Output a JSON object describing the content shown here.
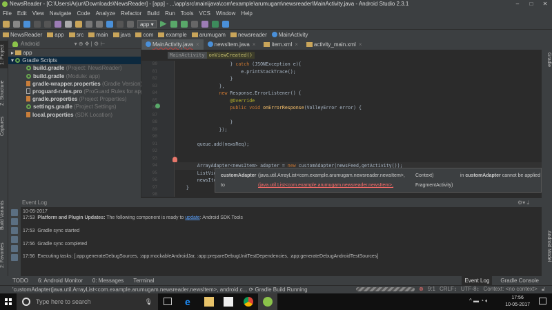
{
  "window": {
    "title": "NewsReader - [C:\\Users\\Arjun\\Downloads\\NewsReader] - [app] - ...\\app\\src\\main\\java\\com\\example\\arumugam\\newsreader\\MainActivity.java - Android Studio 2.3.1"
  },
  "menu": [
    "File",
    "Edit",
    "View",
    "Navigate",
    "Code",
    "Analyze",
    "Refactor",
    "Build",
    "Run",
    "Tools",
    "VCS",
    "Window",
    "Help"
  ],
  "toolbar": {
    "run_config": "app"
  },
  "navbar": [
    "NewsReader",
    "app",
    "src",
    "main",
    "java",
    "com",
    "example",
    "arumugam",
    "newsreader",
    "MainActivity"
  ],
  "left_tabs": [
    "1: Project",
    "Z: Structure",
    "Captures",
    "Build Variants",
    "2: Favorites"
  ],
  "right_tabs": [
    "Gradle",
    "Android Model"
  ],
  "project": {
    "view": "Android",
    "tree": [
      {
        "name": "app",
        "hint": "",
        "icon": "folder",
        "level": 0
      },
      {
        "name": "Gradle Scripts",
        "hint": "",
        "icon": "gradle",
        "level": 0,
        "selected": true
      },
      {
        "name": "build.gradle",
        "hint": "(Project: NewsReader)",
        "icon": "gradle",
        "level": 1
      },
      {
        "name": "build.gradle",
        "hint": "(Module: app)",
        "icon": "gradle",
        "level": 1
      },
      {
        "name": "gradle-wrapper.properties",
        "hint": "(Gradle Version)",
        "icon": "props",
        "level": 1
      },
      {
        "name": "proguard-rules.pro",
        "hint": "(ProGuard Rules for app)",
        "icon": "text",
        "level": 1
      },
      {
        "name": "gradle.properties",
        "hint": "(Project Properties)",
        "icon": "props",
        "level": 1
      },
      {
        "name": "settings.gradle",
        "hint": "(Project Settings)",
        "icon": "gradle",
        "level": 1
      },
      {
        "name": "local.properties",
        "hint": "(SDK Location)",
        "icon": "props",
        "level": 1
      }
    ]
  },
  "editor": {
    "tabs": [
      {
        "label": "MainActivity.java",
        "icon": "class",
        "active": true
      },
      {
        "label": "newsItem.java",
        "icon": "class"
      },
      {
        "label": "item.xml",
        "icon": "xml"
      },
      {
        "label": "activity_main.xml",
        "icon": "xml"
      }
    ],
    "breadcrumb": [
      "MainActivity",
      "onViewCreated()"
    ],
    "lines": [
      {
        "n": "80",
        "segs": [
          [
            "                    } ",
            ""
          ],
          [
            "catch",
            "k"
          ],
          [
            " (JSONException e){",
            ""
          ]
        ]
      },
      {
        "n": "81",
        "segs": [
          [
            "                        e.printStackTrace();",
            ""
          ]
        ]
      },
      {
        "n": "82",
        "segs": [
          [
            "                    }",
            ""
          ]
        ]
      },
      {
        "n": "83",
        "segs": [
          [
            "                },",
            ""
          ]
        ]
      },
      {
        "n": "84",
        "segs": [
          [
            "                ",
            ""
          ],
          [
            "new",
            "k"
          ],
          [
            " Response.ErrorListener() {",
            ""
          ]
        ]
      },
      {
        "n": "85",
        "segs": [
          [
            "                    ",
            ""
          ],
          [
            "@Override",
            "a"
          ]
        ]
      },
      {
        "n": "86",
        "segs": [
          [
            "                    ",
            ""
          ],
          [
            "public void",
            "k"
          ],
          [
            " ",
            ""
          ],
          [
            "onErrorResponse",
            "f"
          ],
          [
            "(VolleyError error) {",
            ""
          ]
        ]
      },
      {
        "n": "87",
        "segs": [
          [
            "",
            ""
          ]
        ]
      },
      {
        "n": "88",
        "segs": [
          [
            "                    }",
            ""
          ]
        ]
      },
      {
        "n": "89",
        "segs": [
          [
            "                });",
            ""
          ]
        ]
      },
      {
        "n": "90",
        "segs": [
          [
            "",
            ""
          ]
        ]
      },
      {
        "n": "91",
        "segs": [
          [
            "        queue.add(newsReq);",
            ""
          ]
        ]
      },
      {
        "n": "92",
        "segs": [
          [
            "",
            ""
          ]
        ]
      },
      {
        "n": "93",
        "segs": [
          [
            "",
            ""
          ]
        ]
      },
      {
        "n": "94",
        "segs": [
          [
            "        ArrayAdapter<newsItem> adapter = ",
            ""
          ],
          [
            "new",
            "k"
          ],
          [
            " customAdapter(",
            ""
          ],
          [
            "newsFeed,getActivity()",
            "e"
          ],
          [
            ");",
            ""
          ]
        ],
        "current": true
      },
      {
        "n": "95",
        "segs": [
          [
            "        ListView newsItems = (ListView) getActivity().findViewById(R.id.newsItems);",
            ""
          ]
        ]
      },
      {
        "n": "96",
        "segs": [
          [
            "        newsItems.setAdapter(adapter);",
            ""
          ]
        ]
      },
      {
        "n": "97",
        "segs": [
          [
            "    }",
            ""
          ]
        ]
      },
      {
        "n": "98",
        "segs": [
          [
            "",
            ""
          ]
        ]
      }
    ]
  },
  "tooltip": {
    "method": "customAdapter",
    "expected_arg1": "(java.util.ArrayList<com.example.arumugam.newsreader.newsItem>,",
    "expected_arg2": "Context)",
    "message_prefix": "in",
    "message_class": "customAdapter",
    "message_suffix": "cannot be applied",
    "to": "to",
    "actual_arg1": "(java.util.List<com.example.arumugam.newsreader.newsItem>,",
    "actual_arg2": "FragmentActivity)"
  },
  "event_log": {
    "title": "Event Log",
    "date": "10-05-2017",
    "entries": [
      {
        "time": "17:53",
        "bold": "Platform and Plugin Updates:",
        "text": "The following component is ready to",
        "link": "update",
        "after": ": Android SDK Tools"
      },
      {
        "time": "17:53",
        "text": "Gradle sync started"
      },
      {
        "time": "17:56",
        "text": "Gradle sync completed"
      },
      {
        "time": "17:56",
        "text": "Executing tasks: [:app:generateDebugSources, :app:mockableAndroidJar, :app:prepareDebugUnitTestDependencies, :app:generateDebugAndroidTestSources]"
      }
    ]
  },
  "bottom_tabs": [
    "TODO",
    "6: Android Monitor",
    "0: Messages",
    "Terminal"
  ],
  "bottom_right_tabs": [
    "Event Log",
    "Gradle Console"
  ],
  "status": {
    "message": "'customAdapter(java.util.ArrayList<com.example.arumugam.newsreader.newsItem>, android.c...",
    "build": "Gradle Build Running",
    "position": "9:1",
    "line_sep": "CRLF↕",
    "encoding": "UTF-8↕",
    "context": "Context: <no context>"
  },
  "taskbar": {
    "search_placeholder": "Type here to search",
    "time": "17:56",
    "date": "10-05-2017"
  }
}
